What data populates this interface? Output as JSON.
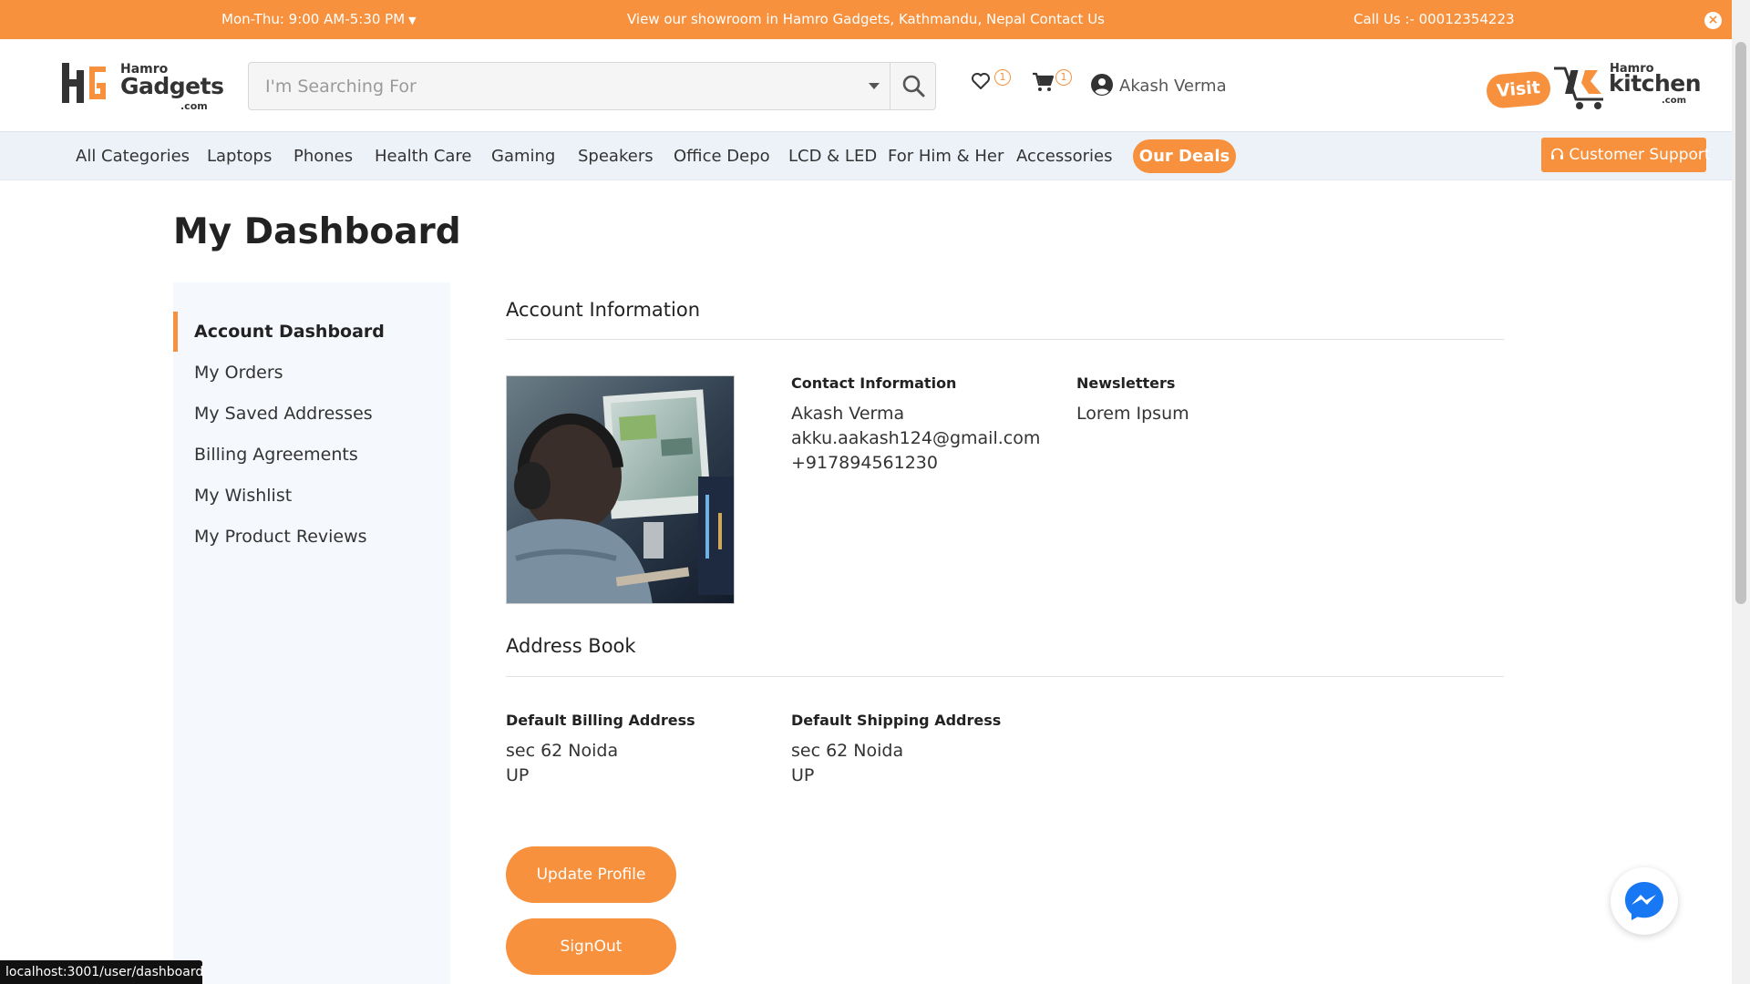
{
  "topbar": {
    "hours": "Mon-Thu: 9:00 AM-5:30 PM",
    "promo": "View our showroom in Hamro Gadgets, Kathmandu, Nepal Contact Us",
    "call": "Call Us :- 00012354223",
    "close_glyph": "×"
  },
  "header": {
    "logo": {
      "top": "Hamro",
      "main": "Gadgets",
      "suffix": ".com"
    },
    "search": {
      "placeholder": "I'm Searching For"
    },
    "wishlist_count": "1",
    "cart_count": "1",
    "user_name": "Akash Verma",
    "visit_label": "Visit",
    "kitchen_logo": {
      "top": "Hamro",
      "main": "kitchen",
      "suffix": ".com"
    }
  },
  "nav": {
    "items": [
      "All Categories",
      "Laptops",
      "Phones",
      "Health Care",
      "Gaming",
      "Speakers",
      "Office Depo",
      "LCD & LED",
      "For Him & Her",
      "Accessories"
    ],
    "deals": "Our Deals",
    "support": "Customer Support"
  },
  "page": {
    "title": "My Dashboard"
  },
  "sidebar": {
    "links": [
      "Account Dashboard",
      "My Orders",
      "My Saved Addresses",
      "Billing Agreements",
      "My Wishlist",
      "My Product Reviews"
    ],
    "active_index": 0
  },
  "account": {
    "section_title": "Account Information",
    "contact_label": "Contact Information",
    "name": "Akash Verma",
    "email": "akku.aakash124@gmail.com",
    "phone": "+917894561230",
    "newsletters_label": "Newsletters",
    "newsletters_value": "Lorem Ipsum"
  },
  "address_book": {
    "section_title": "Address Book",
    "billing_label": "Default Billing Address",
    "billing_line1": "sec 62 Noida",
    "billing_line2": "UP",
    "shipping_label": "Default Shipping Address",
    "shipping_line1": "sec 62 Noida",
    "shipping_line2": "UP"
  },
  "actions": {
    "update_profile": "Update Profile",
    "signout": "SignOut"
  },
  "status_url": "localhost:3001/user/dashboard",
  "icons": [
    "chevron-down-icon",
    "close-icon",
    "search-icon",
    "heart-icon",
    "cart-icon",
    "user-icon",
    "headset-icon",
    "messenger-icon"
  ],
  "colors": {
    "brand_orange": "#f7913d",
    "nav_bg": "#edf2f9",
    "sidebar_bg": "#f5f8fd",
    "messenger_blue": "#1877f2"
  }
}
